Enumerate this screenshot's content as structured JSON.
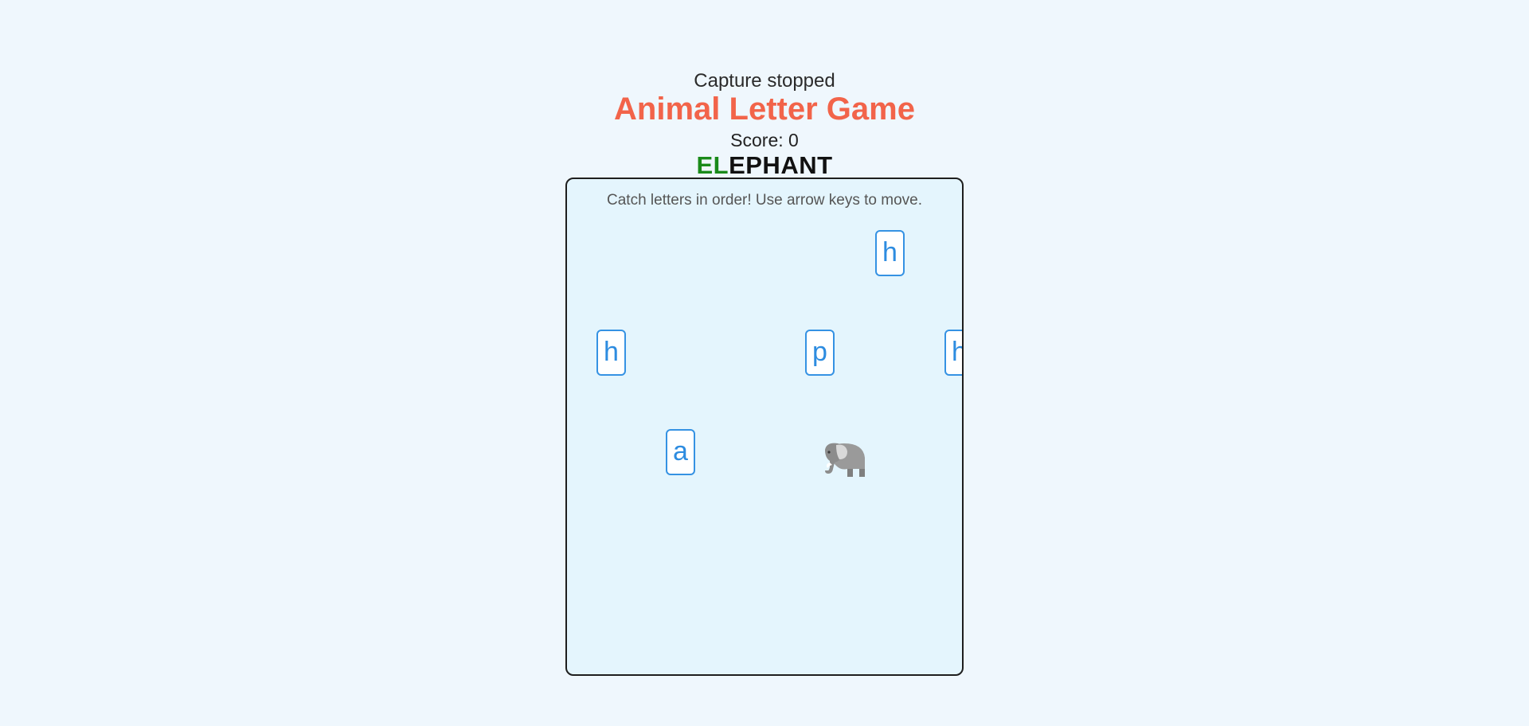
{
  "header": {
    "status": "Capture stopped",
    "title": "Animal Letter Game",
    "score_text": "Score: 0",
    "word_caught": "EL",
    "word_remaining": "EPHANT"
  },
  "board": {
    "instructions": "Catch letters in order! Use arrow keys to move.",
    "letters": [
      "h",
      "h",
      "p",
      "h",
      "a"
    ],
    "player": "elephant-icon"
  },
  "colors": {
    "title": "#f2644a",
    "caught": "#1a8a1a",
    "letter": "#2d8ce0",
    "board_bg": "#e4f5fd"
  }
}
